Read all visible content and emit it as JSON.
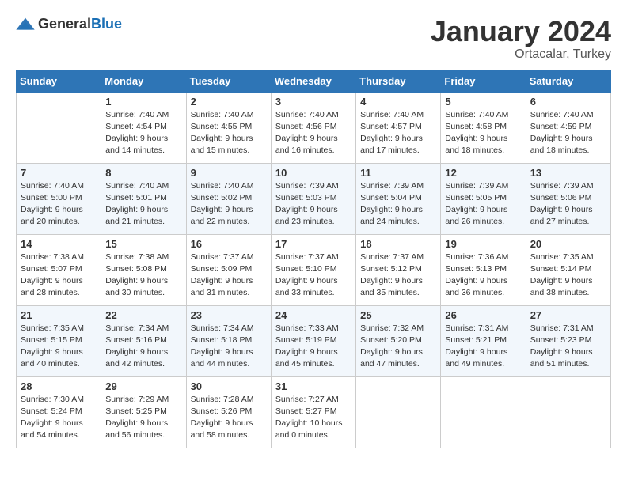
{
  "header": {
    "logo": {
      "general": "General",
      "blue": "Blue"
    },
    "title": "January 2024",
    "location": "Ortacalar, Turkey"
  },
  "weekdays": [
    "Sunday",
    "Monday",
    "Tuesday",
    "Wednesday",
    "Thursday",
    "Friday",
    "Saturday"
  ],
  "weeks": [
    [
      {
        "day": "",
        "sunrise": "",
        "sunset": "",
        "daylight": ""
      },
      {
        "day": "1",
        "sunrise": "Sunrise: 7:40 AM",
        "sunset": "Sunset: 4:54 PM",
        "daylight": "Daylight: 9 hours and 14 minutes."
      },
      {
        "day": "2",
        "sunrise": "Sunrise: 7:40 AM",
        "sunset": "Sunset: 4:55 PM",
        "daylight": "Daylight: 9 hours and 15 minutes."
      },
      {
        "day": "3",
        "sunrise": "Sunrise: 7:40 AM",
        "sunset": "Sunset: 4:56 PM",
        "daylight": "Daylight: 9 hours and 16 minutes."
      },
      {
        "day": "4",
        "sunrise": "Sunrise: 7:40 AM",
        "sunset": "Sunset: 4:57 PM",
        "daylight": "Daylight: 9 hours and 17 minutes."
      },
      {
        "day": "5",
        "sunrise": "Sunrise: 7:40 AM",
        "sunset": "Sunset: 4:58 PM",
        "daylight": "Daylight: 9 hours and 18 minutes."
      },
      {
        "day": "6",
        "sunrise": "Sunrise: 7:40 AM",
        "sunset": "Sunset: 4:59 PM",
        "daylight": "Daylight: 9 hours and 18 minutes."
      }
    ],
    [
      {
        "day": "7",
        "sunrise": "Sunrise: 7:40 AM",
        "sunset": "Sunset: 5:00 PM",
        "daylight": "Daylight: 9 hours and 20 minutes."
      },
      {
        "day": "8",
        "sunrise": "Sunrise: 7:40 AM",
        "sunset": "Sunset: 5:01 PM",
        "daylight": "Daylight: 9 hours and 21 minutes."
      },
      {
        "day": "9",
        "sunrise": "Sunrise: 7:40 AM",
        "sunset": "Sunset: 5:02 PM",
        "daylight": "Daylight: 9 hours and 22 minutes."
      },
      {
        "day": "10",
        "sunrise": "Sunrise: 7:39 AM",
        "sunset": "Sunset: 5:03 PM",
        "daylight": "Daylight: 9 hours and 23 minutes."
      },
      {
        "day": "11",
        "sunrise": "Sunrise: 7:39 AM",
        "sunset": "Sunset: 5:04 PM",
        "daylight": "Daylight: 9 hours and 24 minutes."
      },
      {
        "day": "12",
        "sunrise": "Sunrise: 7:39 AM",
        "sunset": "Sunset: 5:05 PM",
        "daylight": "Daylight: 9 hours and 26 minutes."
      },
      {
        "day": "13",
        "sunrise": "Sunrise: 7:39 AM",
        "sunset": "Sunset: 5:06 PM",
        "daylight": "Daylight: 9 hours and 27 minutes."
      }
    ],
    [
      {
        "day": "14",
        "sunrise": "Sunrise: 7:38 AM",
        "sunset": "Sunset: 5:07 PM",
        "daylight": "Daylight: 9 hours and 28 minutes."
      },
      {
        "day": "15",
        "sunrise": "Sunrise: 7:38 AM",
        "sunset": "Sunset: 5:08 PM",
        "daylight": "Daylight: 9 hours and 30 minutes."
      },
      {
        "day": "16",
        "sunrise": "Sunrise: 7:37 AM",
        "sunset": "Sunset: 5:09 PM",
        "daylight": "Daylight: 9 hours and 31 minutes."
      },
      {
        "day": "17",
        "sunrise": "Sunrise: 7:37 AM",
        "sunset": "Sunset: 5:10 PM",
        "daylight": "Daylight: 9 hours and 33 minutes."
      },
      {
        "day": "18",
        "sunrise": "Sunrise: 7:37 AM",
        "sunset": "Sunset: 5:12 PM",
        "daylight": "Daylight: 9 hours and 35 minutes."
      },
      {
        "day": "19",
        "sunrise": "Sunrise: 7:36 AM",
        "sunset": "Sunset: 5:13 PM",
        "daylight": "Daylight: 9 hours and 36 minutes."
      },
      {
        "day": "20",
        "sunrise": "Sunrise: 7:35 AM",
        "sunset": "Sunset: 5:14 PM",
        "daylight": "Daylight: 9 hours and 38 minutes."
      }
    ],
    [
      {
        "day": "21",
        "sunrise": "Sunrise: 7:35 AM",
        "sunset": "Sunset: 5:15 PM",
        "daylight": "Daylight: 9 hours and 40 minutes."
      },
      {
        "day": "22",
        "sunrise": "Sunrise: 7:34 AM",
        "sunset": "Sunset: 5:16 PM",
        "daylight": "Daylight: 9 hours and 42 minutes."
      },
      {
        "day": "23",
        "sunrise": "Sunrise: 7:34 AM",
        "sunset": "Sunset: 5:18 PM",
        "daylight": "Daylight: 9 hours and 44 minutes."
      },
      {
        "day": "24",
        "sunrise": "Sunrise: 7:33 AM",
        "sunset": "Sunset: 5:19 PM",
        "daylight": "Daylight: 9 hours and 45 minutes."
      },
      {
        "day": "25",
        "sunrise": "Sunrise: 7:32 AM",
        "sunset": "Sunset: 5:20 PM",
        "daylight": "Daylight: 9 hours and 47 minutes."
      },
      {
        "day": "26",
        "sunrise": "Sunrise: 7:31 AM",
        "sunset": "Sunset: 5:21 PM",
        "daylight": "Daylight: 9 hours and 49 minutes."
      },
      {
        "day": "27",
        "sunrise": "Sunrise: 7:31 AM",
        "sunset": "Sunset: 5:23 PM",
        "daylight": "Daylight: 9 hours and 51 minutes."
      }
    ],
    [
      {
        "day": "28",
        "sunrise": "Sunrise: 7:30 AM",
        "sunset": "Sunset: 5:24 PM",
        "daylight": "Daylight: 9 hours and 54 minutes."
      },
      {
        "day": "29",
        "sunrise": "Sunrise: 7:29 AM",
        "sunset": "Sunset: 5:25 PM",
        "daylight": "Daylight: 9 hours and 56 minutes."
      },
      {
        "day": "30",
        "sunrise": "Sunrise: 7:28 AM",
        "sunset": "Sunset: 5:26 PM",
        "daylight": "Daylight: 9 hours and 58 minutes."
      },
      {
        "day": "31",
        "sunrise": "Sunrise: 7:27 AM",
        "sunset": "Sunset: 5:27 PM",
        "daylight": "Daylight: 10 hours and 0 minutes."
      },
      {
        "day": "",
        "sunrise": "",
        "sunset": "",
        "daylight": ""
      },
      {
        "day": "",
        "sunrise": "",
        "sunset": "",
        "daylight": ""
      },
      {
        "day": "",
        "sunrise": "",
        "sunset": "",
        "daylight": ""
      }
    ]
  ]
}
